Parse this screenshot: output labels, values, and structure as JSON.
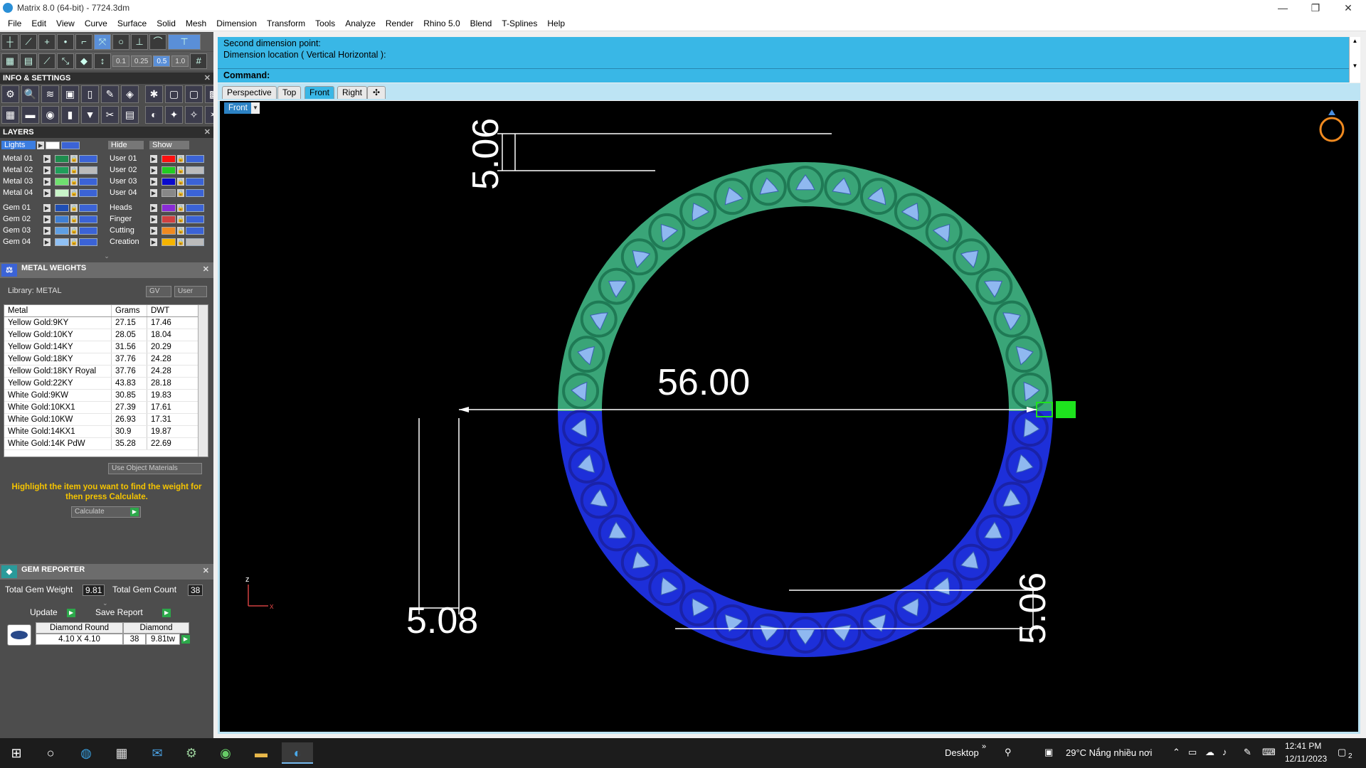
{
  "window": {
    "title": "Matrix 8.0 (64-bit) - 7724.3dm",
    "minimize": "—",
    "maximize": "❐",
    "close": "✕"
  },
  "menu": [
    "File",
    "Edit",
    "View",
    "Curve",
    "Surface",
    "Solid",
    "Mesh",
    "Dimension",
    "Transform",
    "Tools",
    "Analyze",
    "Render",
    "Rhino 5.0",
    "Blend",
    "T-Splines",
    "Help"
  ],
  "toolbar": {
    "snap_values": [
      "0.1",
      "0.25",
      "0.5",
      "1.0"
    ]
  },
  "info_settings": {
    "title": "INFO & SETTINGS"
  },
  "layers": {
    "title": "LAYERS",
    "lights_label": "Lights",
    "hide_label": "Hide",
    "show_label": "Show",
    "left": [
      {
        "name": "Metal 01",
        "color": "#1e8c4e"
      },
      {
        "name": "Metal 02",
        "color": "#1f9f5a"
      },
      {
        "name": "Metal 03",
        "color": "#6fe06f"
      },
      {
        "name": "Metal 04",
        "color": "#c8f5c8"
      },
      {
        "name": "Gem 01",
        "color": "#1f4fb4"
      },
      {
        "name": "Gem 02",
        "color": "#3f7fd4"
      },
      {
        "name": "Gem 03",
        "color": "#5f9fe4"
      },
      {
        "name": "Gem 04",
        "color": "#8fc0f4"
      }
    ],
    "right": [
      {
        "name": "User 01",
        "color": "#ff1010"
      },
      {
        "name": "User 02",
        "color": "#22cc22"
      },
      {
        "name": "User 03",
        "color": "#0a0acc"
      },
      {
        "name": "User 04",
        "color": "#888888"
      },
      {
        "name": "Heads",
        "color": "#8a2bd6"
      },
      {
        "name": "Finger",
        "color": "#d04040"
      },
      {
        "name": "Cutting",
        "color": "#f08a20"
      },
      {
        "name": "Creation",
        "color": "#f5b400"
      }
    ]
  },
  "metal_weights": {
    "title": "METAL WEIGHTS",
    "library": "Library: METAL",
    "gv_label": "GV",
    "user_label": "User",
    "columns": [
      "Metal",
      "Grams",
      "DWT"
    ],
    "rows": [
      [
        "Yellow Gold:9KY",
        "27.15",
        "17.46"
      ],
      [
        "Yellow Gold:10KY",
        "28.05",
        "18.04"
      ],
      [
        "Yellow Gold:14KY",
        "31.56",
        "20.29"
      ],
      [
        "Yellow Gold:18KY",
        "37.76",
        "24.28"
      ],
      [
        "Yellow Gold:18KY Royal",
        "37.76",
        "24.28"
      ],
      [
        "Yellow Gold:22KY",
        "43.83",
        "28.18"
      ],
      [
        "White Gold:9KW",
        "30.85",
        "19.83"
      ],
      [
        "White Gold:10KX1",
        "27.39",
        "17.61"
      ],
      [
        "White Gold:10KW",
        "26.93",
        "17.31"
      ],
      [
        "White Gold:14KX1",
        "30.9",
        "19.87"
      ],
      [
        "White Gold:14K PdW",
        "35.28",
        "22.69"
      ]
    ],
    "use_object_materials": "Use Object Materials",
    "hint": "Highlight the item you want to find the weight for then press Calculate.",
    "calculate": "Calculate"
  },
  "gem_reporter": {
    "title": "GEM REPORTER",
    "total_weight_label": "Total Gem Weight",
    "total_weight": "9.81",
    "total_count_label": "Total Gem Count",
    "total_count": "38",
    "update": "Update",
    "save_report": "Save Report",
    "gem_type": "Diamond Round",
    "gem_material": "Diamond",
    "gem_size": "4.10 X 4.10",
    "gem_count": "38",
    "gem_weight": "9.81tw"
  },
  "command": {
    "line1": "Second dimension point:",
    "line2": "Dimension location ( Vertical  Horizontal ):",
    "label": "Command:"
  },
  "viewtabs": [
    "Perspective",
    "Top",
    "Front",
    "Right"
  ],
  "viewport": {
    "label": "Front",
    "dims": {
      "top": "5.06",
      "diameter": "56.00",
      "bottom_left": "5.08",
      "bottom_right": "5.06"
    },
    "axis_z": "z",
    "axis_x": "x"
  },
  "taskbar": {
    "desktop": "Desktop",
    "weather": "29°C  Nắng nhiều nơi",
    "time": "12:41 PM",
    "date": "12/11/2023",
    "notif_count": "2"
  }
}
